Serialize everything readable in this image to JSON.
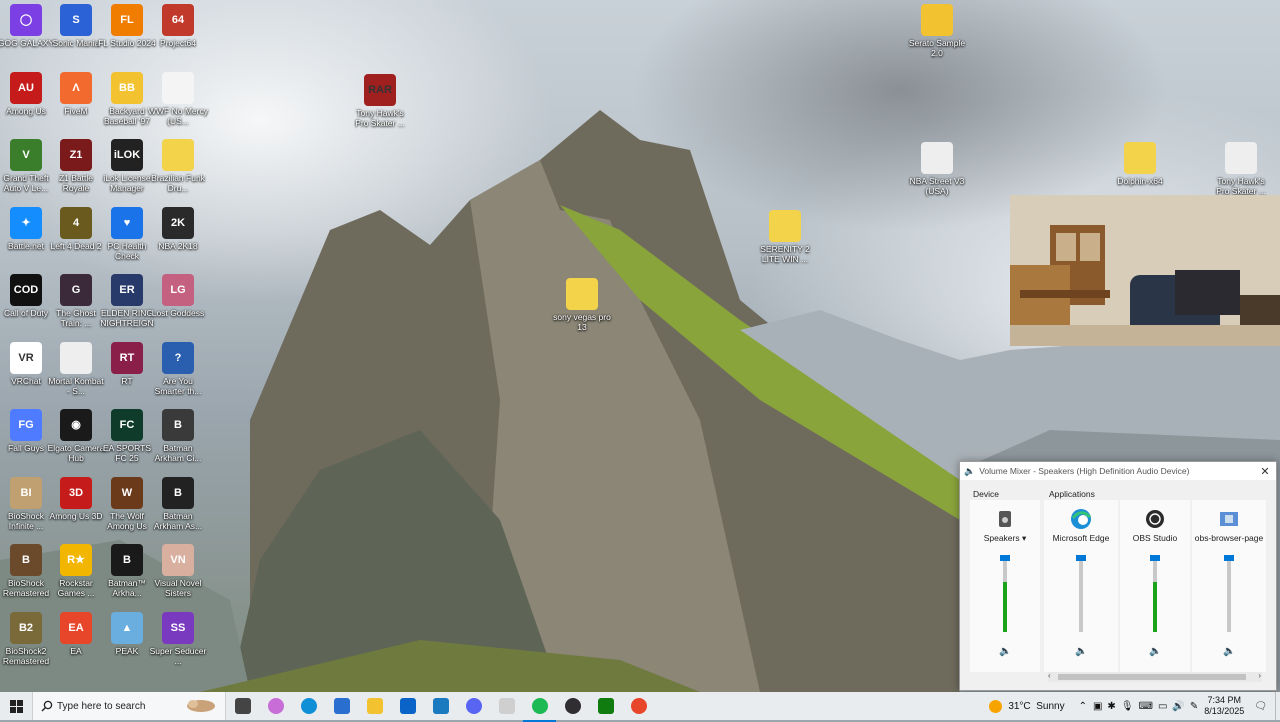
{
  "desktop_icons": [
    {
      "label": "GOG GALAXY",
      "color": "#7b3fe4",
      "glyph": "◯"
    },
    {
      "label": "Sonic Mania",
      "color": "#2b62d6",
      "glyph": "S"
    },
    {
      "label": "FL Studio 2024",
      "color": "#f07c00",
      "glyph": "FL"
    },
    {
      "label": "Project64",
      "color": "#c0392b",
      "glyph": "64"
    },
    {
      "label": "Among Us",
      "color": "#c51b1b",
      "glyph": "AU"
    },
    {
      "label": "FiveM",
      "color": "#f26a2e",
      "glyph": "Λ"
    },
    {
      "label": "Backyard Baseball '97",
      "color": "#f2c230",
      "glyph": "BB"
    },
    {
      "label": "WWF No Mercy (US...",
      "color": "#f4f4f4",
      "glyph": ""
    },
    {
      "label": "Grand Theft Auto V Le...",
      "color": "#3a7d2a",
      "glyph": "V"
    },
    {
      "label": "Z1 Battle Royale",
      "color": "#7a1a1a",
      "glyph": "Z1"
    },
    {
      "label": "iLok License Manager",
      "color": "#222222",
      "glyph": "iLOK"
    },
    {
      "label": "Brazilian Funk Dru...",
      "color": "#f2d34a",
      "glyph": ""
    },
    {
      "label": "Battle.net",
      "color": "#148eff",
      "glyph": "✦"
    },
    {
      "label": "Left 4 Dead 2",
      "color": "#6b5a1e",
      "glyph": "4"
    },
    {
      "label": "PC Health Check",
      "color": "#1a73e8",
      "glyph": "♥"
    },
    {
      "label": "NBA 2K18",
      "color": "#2a2a2a",
      "glyph": "2K"
    },
    {
      "label": "Call of Duty",
      "color": "#111111",
      "glyph": "COD"
    },
    {
      "label": "The Ghost Train: ...",
      "color": "#3a2a3a",
      "glyph": "G"
    },
    {
      "label": "ELDEN RING NIGHTREIGN",
      "color": "#283a6a",
      "glyph": "ER"
    },
    {
      "label": "Lost Goddess",
      "color": "#c46080",
      "glyph": "LG"
    },
    {
      "label": "VRChat",
      "color": "#ffffff",
      "glyph": "VR"
    },
    {
      "label": "Mortal Kombat - S...",
      "color": "#eeeeee",
      "glyph": ""
    },
    {
      "label": "RT",
      "color": "#8a1f4a",
      "glyph": "RT"
    },
    {
      "label": "Are You Smarter th...",
      "color": "#2a5fb0",
      "glyph": "?"
    },
    {
      "label": "Fall Guys",
      "color": "#4e7bff",
      "glyph": "FG"
    },
    {
      "label": "Elgato Camera Hub",
      "color": "#1a1a1a",
      "glyph": "◉"
    },
    {
      "label": "EA SPORTS FC 25",
      "color": "#0e3b2a",
      "glyph": "FC"
    },
    {
      "label": "Batman Arkham Ci...",
      "color": "#3a3a3a",
      "glyph": "B"
    },
    {
      "label": "BioShock Infinite ...",
      "color": "#c0a070",
      "glyph": "BI"
    },
    {
      "label": "Among Us 3D",
      "color": "#c51b1b",
      "glyph": "3D"
    },
    {
      "label": "The Wolf Among Us",
      "color": "#6a3a1a",
      "glyph": "W"
    },
    {
      "label": "Batman Arkham As...",
      "color": "#222222",
      "glyph": "B"
    },
    {
      "label": "BioShock Remastered",
      "color": "#6a4a2a",
      "glyph": "B"
    },
    {
      "label": "Rockstar Games ...",
      "color": "#f2b600",
      "glyph": "R★"
    },
    {
      "label": "Batman™ Arkha...",
      "color": "#1a1a1a",
      "glyph": "B"
    },
    {
      "label": "Visual Novel Sisters",
      "color": "#d9b0a0",
      "glyph": "VN"
    },
    {
      "label": "BioShock2 Remastered",
      "color": "#7a6a3a",
      "glyph": "B2"
    },
    {
      "label": "EA",
      "color": "#e8462a",
      "glyph": "EA"
    },
    {
      "label": "PEAK",
      "color": "#6aaee0",
      "glyph": "▲"
    },
    {
      "label": "Super Seducer ...",
      "color": "#7a3ac0",
      "glyph": "SS"
    }
  ],
  "loose_icons": [
    {
      "label": "Tony Hawk's Pro Skater ...",
      "color": "#a02020",
      "glyph": "RAR"
    },
    {
      "label": "sony vegas pro 13",
      "color": "#f2d34a",
      "glyph": ""
    },
    {
      "label": "SERENITY 2 LITE WIN ...",
      "color": "#f2d34a",
      "glyph": ""
    },
    {
      "label": "Serato Sample 2.0",
      "color": "#f2c230",
      "glyph": ""
    },
    {
      "label": "NBA Street V3 (USA)",
      "color": "#eeeeee",
      "glyph": ""
    },
    {
      "label": "Dolphin-x64",
      "color": "#f2d34a",
      "glyph": ""
    },
    {
      "label": "Tony Hawk's Pro Skater ...",
      "color": "#eeeeee",
      "glyph": ""
    }
  ],
  "mixer": {
    "title": "Volume Mixer - Speakers (High Definition Audio Device)",
    "close": "✕",
    "device_group": "Device",
    "apps_group": "Applications",
    "channels": [
      {
        "name": "Speakers",
        "level": 0.7,
        "dropdown": "▾"
      },
      {
        "name": "Microsoft Edge",
        "level": 0
      },
      {
        "name": "OBS Studio",
        "level": 0.7
      },
      {
        "name": "obs-browser-page",
        "level": 0
      }
    ],
    "speaker_glyph": "🔈"
  },
  "taskbar": {
    "search_placeholder": "Type here to search",
    "weather": "31°C  Sunny",
    "time": "7:34 PM",
    "date": "8/13/2025",
    "pinned": [
      {
        "name": "task-view",
        "color": "#444444"
      },
      {
        "name": "copilot",
        "color": "#c86dd7"
      },
      {
        "name": "edge",
        "color": "#0f8fd6"
      },
      {
        "name": "store",
        "color": "#2a6fd0"
      },
      {
        "name": "file-explorer",
        "color": "#f2c230"
      },
      {
        "name": "outlook",
        "color": "#0a64c8"
      },
      {
        "name": "calculator-app",
        "color": "#1a7ac0"
      },
      {
        "name": "discord",
        "color": "#5865f2"
      },
      {
        "name": "tablet-app",
        "color": "#cfcfcf"
      },
      {
        "name": "spotify",
        "color": "#1db954"
      },
      {
        "name": "obs",
        "color": "#302e31"
      },
      {
        "name": "xbox",
        "color": "#107c10"
      },
      {
        "name": "origin",
        "color": "#e8462a"
      }
    ]
  }
}
